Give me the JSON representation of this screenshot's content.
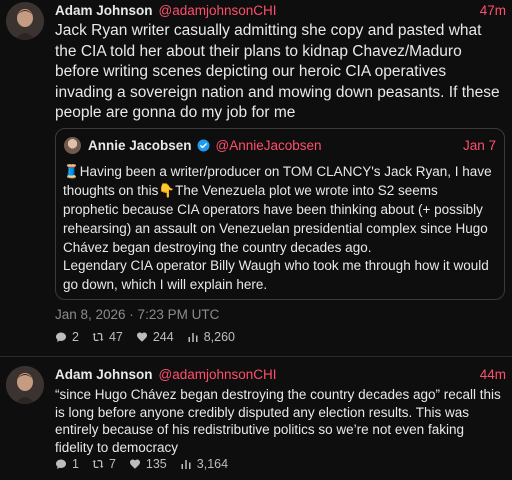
{
  "posts": [
    {
      "author_name": "Adam Johnson",
      "handle": "@adamjohnsonCHI",
      "time_ago": "47m",
      "text": "Jack Ryan writer casually admitting she copy and pasted what the CIA told her about their plans to kidnap Chavez/Maduro before writing scenes depicting our heroic CIA operatives invading a sovereign nation and mowing down peasants. If these people are gonna do my job for me",
      "quote": {
        "author_name": "Annie Jacobsen",
        "handle": "@AnnieJacobsen",
        "date": "Jan 7",
        "verified_icon": "verified-badge-icon",
        "text_para1": "🧵Having been a writer/producer on TOM CLANCY's Jack Ryan, I have thoughts on this👇The Venezuela plot we wrote into S2 seems prophetic because CIA operators have been thinking about (+ possibly rehearsing) an assault on Venezuelan presidential complex since Hugo Chávez began destroying the country decades ago.",
        "text_para2": "Legendary CIA operator Billy Waugh who took me through how it would go down, which I will explain here."
      },
      "timestamp": "Jan 8, 2026 · 7:23 PM UTC",
      "stats": {
        "replies": "2",
        "retweets": "47",
        "likes": "244",
        "views": "8,260"
      }
    },
    {
      "author_name": "Adam Johnson",
      "handle": "@adamjohnsonCHI",
      "time_ago": "44m",
      "text": "“since Hugo Chávez began destroying the country decades ago” recall this is long before anyone credibly disputed any election results. This was entirely because of his redistributive politics so we’re not even faking fidelity to democracy",
      "stats": {
        "replies": "1",
        "retweets": "7",
        "likes": "135",
        "views": "3,164"
      }
    }
  ],
  "colors": {
    "background": "#0e0e0e",
    "text": "#e7e9ea",
    "accent": "#ff4f6e",
    "muted": "#8b8b8b",
    "verified": "#1d9bf0"
  }
}
